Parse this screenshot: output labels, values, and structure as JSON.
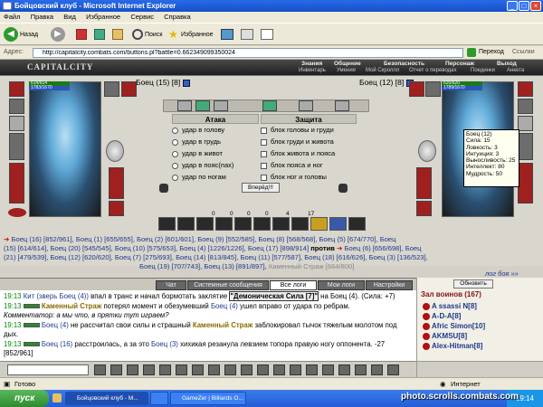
{
  "window": {
    "title": "Бойцовский клуб - Microsoft Internet Explorer"
  },
  "menu": [
    "Файл",
    "Правка",
    "Вид",
    "Избранное",
    "Сервис",
    "Справка"
  ],
  "toolbar": {
    "back": "Назад",
    "search": "Поиск",
    "favorites": "Избранное"
  },
  "address": {
    "label": "Адрес:",
    "value": "http://capitalcity.combats.com/buttons.pl?battle=0.662349099350024",
    "go": "Переход",
    "links": "Ссылки"
  },
  "game": {
    "logo": "CAPITALCITY",
    "nav_top": [
      "Знания",
      "Общение",
      "Безопасность",
      "Персонаж",
      "Выход"
    ],
    "nav_bottom": [
      "Инвентарь",
      "Умения",
      "Мой Скроллл",
      "Отчет о переводах",
      "Поединки",
      "Анкета"
    ]
  },
  "left_fighter": {
    "name": "Боец (15) [8]",
    "hp": "614/614",
    "mp": "1783/1670"
  },
  "right_fighter": {
    "name": "Боец (12) [8]",
    "hp": "620/620",
    "mp": "1789/1670"
  },
  "attack": {
    "title": "Атака",
    "options": [
      "удар в голову",
      "удар в грудь",
      "удар в живот",
      "удар в пояс(пах)",
      "удар по ногам"
    ]
  },
  "defense": {
    "title": "Защита",
    "options": [
      "блок головы и груди",
      "блок груди и живота",
      "блок живота и пояса",
      "блок пояса и ног",
      "блок ног и головы"
    ]
  },
  "forward_button": "Вперёд!!!",
  "tooltip": {
    "lines": [
      "Боец (12)",
      "Сила: 15",
      "Ловкость: 3",
      "Интуиция: 3",
      "Выносливость: 25",
      "Интеллект: 80",
      "Мудрость: 50"
    ]
  },
  "counters": [
    "0",
    "0",
    "0",
    "0",
    "4",
    "17"
  ],
  "teams": {
    "line1": "Боец (16) [852/961], Боец (1) [655/655], Боец (2) [601/601], Боец (9) [552/585], Боец (8) [568/568], Боец (5) [674/770], Боец",
    "line2": "(15) [614/614], Боец (20) [545/545], Боец (10) [575/653], Боец (4) [1226/1226], Боец (17) [898/914]",
    "versus": "против",
    "line2b": "Боец (6) [656/698], Боец",
    "line3": "(21) [479/539], Боец (12) [620/620], Боец (7) [275/693], Боец (14) [813/845], Боец (11) [577/587], Боец (18) [616/626], Боец (3) [136/523],",
    "line4a": "Боец (19) [707/743], Боец (13) [891/897],",
    "line4b": "Каменный Страж [684/800]"
  },
  "more_link": "лог боя »»",
  "chat_tabs": [
    "Чат",
    "Системные сообщения",
    "Все логи",
    "Мои логи",
    "Настройки"
  ],
  "chat_lines": [
    {
      "time": "19:13",
      "pre": "Кит (зверь Боец (4))",
      "text": " впал в транс и начал бормотать заклятие ",
      "bold": "\"Демоническая Сила [7]\"",
      "post": " на Боец (4). (Сила: +7)"
    },
    {
      "time": "19:13",
      "pre": "Каменный Страж",
      "text": " потерял момент и обезумевший ",
      "bold": "Боец (4)",
      "post": " ушел вправо от удара по ребрам."
    },
    {
      "time": "",
      "pre": "",
      "text": "Комментатор: а мы что, в прятки тут играем?",
      "bold": "",
      "post": ""
    },
    {
      "time": "19:13",
      "pre": "Боец (4)",
      "text": " не рассчитал свои силы и страшный ",
      "bold": "Каменный Страж",
      "post": " заблокировал тычок тяжелым молотом под дых."
    },
    {
      "time": "19:13",
      "pre": "Боец (16)",
      "text": " расстроилась, а за это ",
      "bold": "Боец (3)",
      "post": " хихикая резанула левзием топора правую ногу оппонента. -27 [852/961]"
    }
  ],
  "right_panel": {
    "refresh": "Обновить",
    "room": "Зал воинов (167)",
    "members": [
      "A ssassi N[8]",
      "A-D-A[8]",
      "Afric Simon[10]",
      "AKMSU[8]",
      "Alex-Hitman[8]"
    ]
  },
  "status": {
    "left": "Готово",
    "right": "Интернет"
  },
  "taskbar": {
    "start": "пуск",
    "tasks": [
      "Бойцовский клуб - M...",
      "",
      "GameZer | Billiards O..."
    ],
    "clock": "19:14"
  },
  "watermark": "photo.scrolls.combats.com"
}
